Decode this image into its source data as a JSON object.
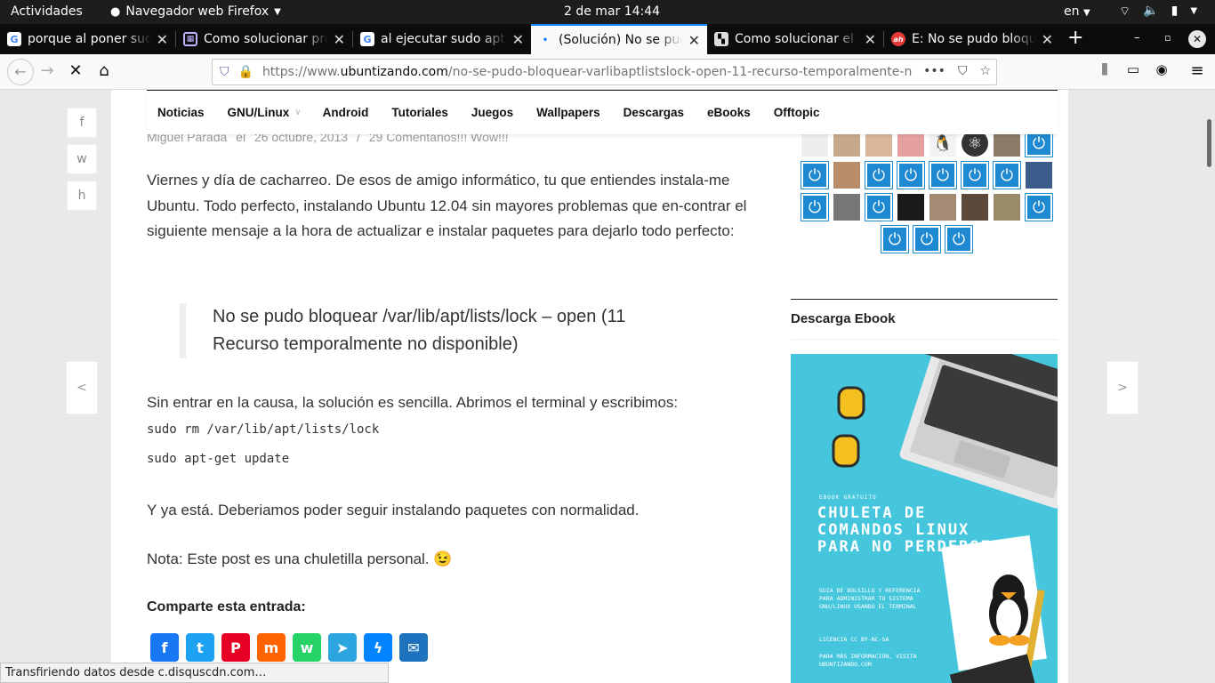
{
  "system": {
    "activities": "Actividades",
    "app_name": "Navegador web Firefox",
    "clock": "2 de mar  14:44",
    "lang": "en"
  },
  "tabs": [
    {
      "title": "porque al poner sudo",
      "favicon": "google-icon"
    },
    {
      "title": "Como solucionar pro",
      "favicon": "grid-icon"
    },
    {
      "title": "al ejecutar sudo apt",
      "favicon": "google-icon"
    },
    {
      "title": "(Solución) No se pudo",
      "favicon": "loading-dot",
      "selected": true
    },
    {
      "title": "Como solucionar el e",
      "favicon": "clapper-icon"
    },
    {
      "title": "E: No se pudo bloque",
      "favicon": "ah-icon"
    }
  ],
  "url": {
    "scheme": "https://www.",
    "domain": "ubuntizando.com",
    "path": "/no-se-pudo-bloquear-varlibaptlistslock-open-11-recurso-temporalmente-n"
  },
  "menu": [
    "Noticias",
    "GNU/Linux",
    "Android",
    "Tutoriales",
    "Juegos",
    "Wallpapers",
    "Descargas",
    "eBooks",
    "Offtopic"
  ],
  "meta": {
    "author": "Miguel Parada",
    "on": "el",
    "date": "26 octubre, 2013",
    "sep": "/",
    "comments": "29 Comentarios!!! Wow!!!"
  },
  "side_share": [
    "f",
    "w",
    "h"
  ],
  "article": {
    "p1": "Viernes y día de cacharreo. De esos de amigo informático, tu que entiendes instala-me Ubuntu. Todo perfecto, instalando Ubuntu 12.04 sin mayores problemas que en-contrar  el siguiente mensaje a la hora de actualizar e instalar paquetes para dejarlo todo perfecto:",
    "quote": "No se pudo bloquear /var/lib/apt/lists/lock – open (11 Recurso temporalmente no disponible)",
    "p2": "Sin entrar en la causa, la solución es sencilla. Abrimos el terminal y escribimos:",
    "code1": "sudo rm /var/lib/apt/lists/lock",
    "code2": "sudo apt-get update",
    "p3": "Y ya está. Deberiamos poder seguir instalando paquetes con normalidad.",
    "p4": "Nota: Este post es una chuletilla personal. 😉"
  },
  "share_title": "Comparte esta entrada:",
  "socials": [
    {
      "name": "facebook",
      "glyph": "f",
      "color": "#1877f2"
    },
    {
      "name": "twitter",
      "glyph": "t",
      "color": "#1da1f2"
    },
    {
      "name": "pinterest",
      "glyph": "P",
      "color": "#e60023"
    },
    {
      "name": "meneame",
      "glyph": "m",
      "color": "#ff6400"
    },
    {
      "name": "whatsapp",
      "glyph": "w",
      "color": "#25d366"
    },
    {
      "name": "telegram",
      "glyph": "➤",
      "color": "#2ca5e0"
    },
    {
      "name": "messenger",
      "glyph": "ϟ",
      "color": "#0084ff"
    },
    {
      "name": "email",
      "glyph": "✉",
      "color": "#1e73be"
    }
  ],
  "nav_arrows": {
    "prev": "<",
    "next": ">"
  },
  "sidebar": {
    "widget_title": "Descarga Ebook",
    "ebook": {
      "small": "EBOOK GRATUITO",
      "title": "CHULETA DE COMANDOS LINUX PARA NO PERDERSE",
      "desc": "GUIA DE BOLSILLO Y REFERENCIA PARA ADMINISTRAR TU SISTEMA GNU/LINUX USANDO EL TERMINAL",
      "license": "LICENCIA CC BY-NC-SA",
      "more": "PARA MÁS INFORMACIÓN, VISITA UBUNTIZANDO.COM"
    }
  },
  "status": "Transfiriendo datos desde c.disquscdn.com…"
}
